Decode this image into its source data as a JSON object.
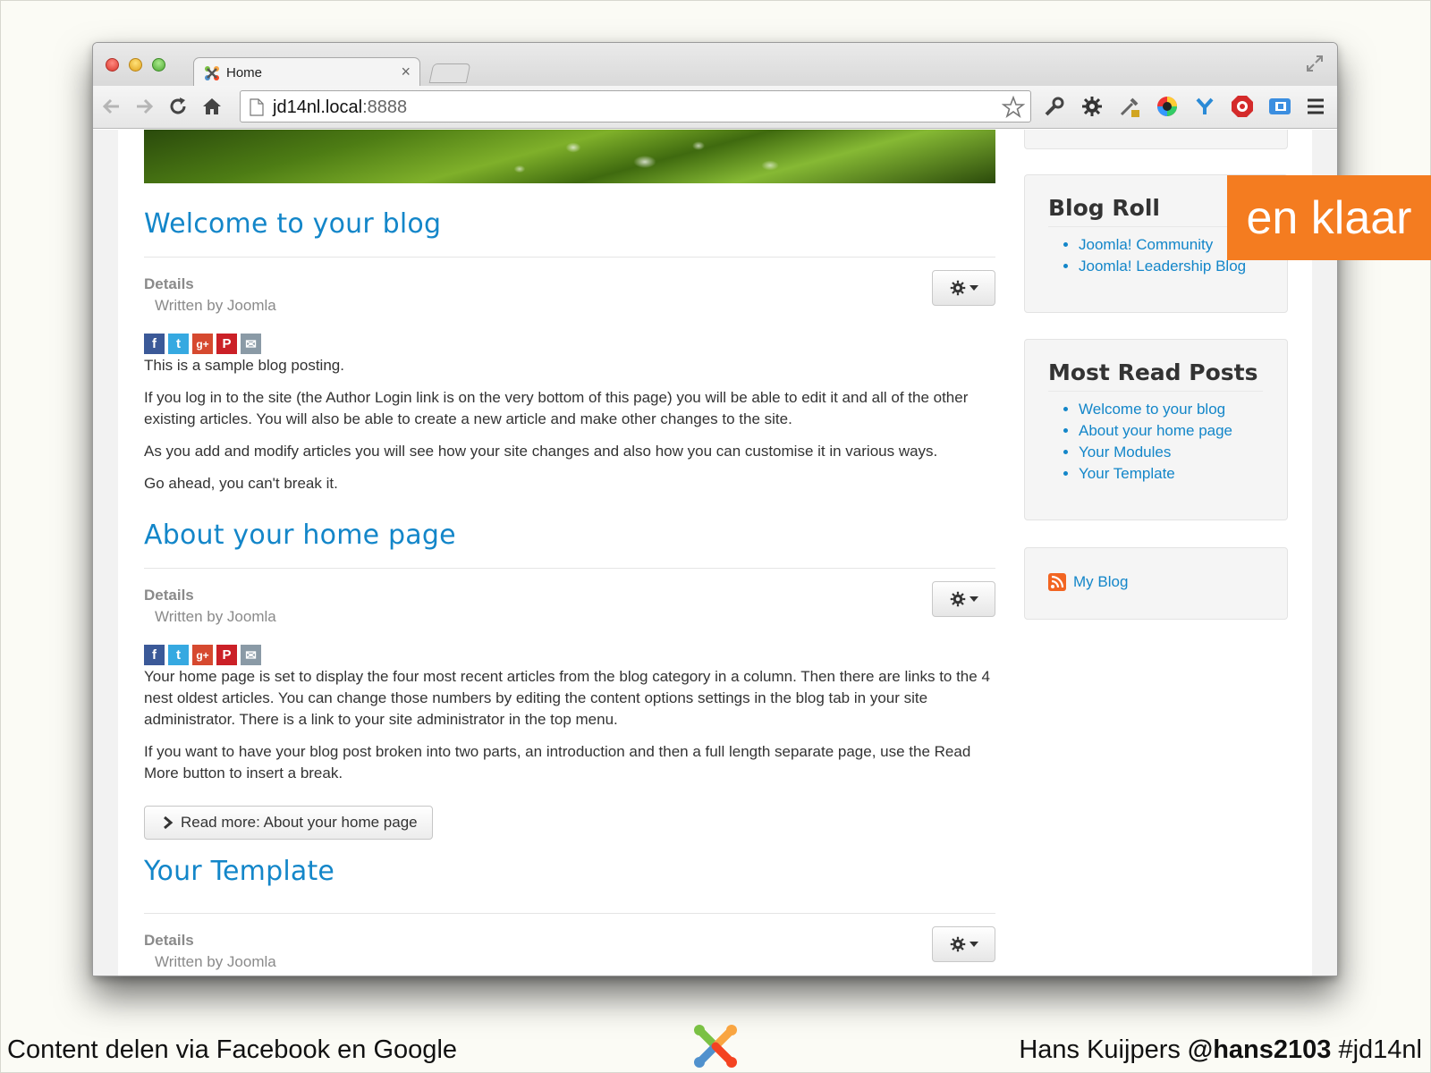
{
  "browser": {
    "tab_title": "Home",
    "tab_close": "×",
    "url_host": "jd14nl.local",
    "url_port": ":8888"
  },
  "articles": [
    {
      "title": "Welcome to your blog",
      "details_label": "Details",
      "written_by": "Written by Joomla",
      "paragraphs": [
        "This is a sample blog posting.",
        "If you log in to the site (the Author Login link is on the very bottom of this page) you will be able to edit it and all of the other existing articles. You will also be able to create a new article and make other changes to the site.",
        "As you add and modify articles you will see how your site changes and also how you can customise it in various ways.",
        "Go ahead, you can't break it."
      ]
    },
    {
      "title": "About your home page",
      "details_label": "Details",
      "written_by": "Written by Joomla",
      "paragraphs": [
        "Your home page is set to display the four most recent articles from the blog category in a column. Then there are links to the 4 nest oldest articles. You can change those numbers by editing the content options settings in the blog tab in your site administrator. There is a link to your site administrator in the top menu.",
        "If you want to have your blog post broken into two parts, an introduction and then a full length separate page, use the Read More button to insert a break."
      ],
      "read_more": "Read more: About your home page"
    },
    {
      "title": "Your Template",
      "details_label": "Details",
      "written_by": "Written by Joomla"
    }
  ],
  "share_icons": {
    "facebook": "f",
    "twitter": "t",
    "googleplus": "g+",
    "pinterest": "P",
    "email": "✉"
  },
  "sidebar": {
    "blog_roll": {
      "title": "Blog Roll",
      "items": [
        "Joomla! Community",
        "Joomla! Leadership Blog"
      ]
    },
    "most_read": {
      "title": "Most Read Posts",
      "items": [
        "Welcome to your blog",
        "About your home page",
        "Your Modules",
        "Your Template"
      ]
    },
    "feed": {
      "label": "My Blog"
    }
  },
  "slide": {
    "badge": "en klaar",
    "footer_left": "Content delen via Facebook en Google",
    "footer_right_name": "Hans Kuijpers ",
    "footer_right_handle": "@hans2103",
    "footer_right_tag": " #jd14nl"
  },
  "colors": {
    "link": "#1386c9",
    "badge": "#f47c20"
  }
}
